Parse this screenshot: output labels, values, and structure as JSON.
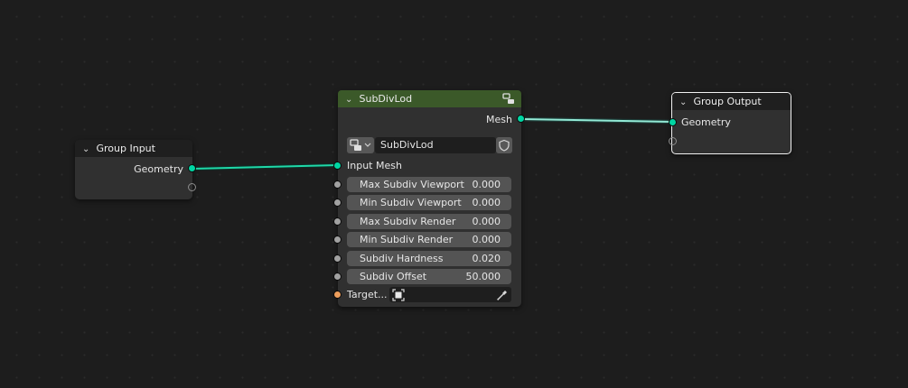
{
  "colors": {
    "geometry_socket": "#00d6a3",
    "float_socket": "#a1a1a1",
    "object_socket": "#ed9e5c",
    "group_header": "#3b5929",
    "input_output_header": "#1f1f1f",
    "link": "#66e0c0"
  },
  "group_input": {
    "title": "Group Input",
    "outputs": [
      {
        "label": "Geometry",
        "type": "geometry"
      }
    ]
  },
  "subdiv_node": {
    "title": "SubDivLod",
    "header_icon": "node-tree-icon",
    "output_label": "Mesh",
    "datablock": {
      "icon": "node-tree-icon",
      "name": "SubDivLod",
      "fake_user_icon": "shield-icon"
    },
    "input_mesh_label": "Input Mesh",
    "fields": [
      {
        "name": "Max Subdiv Viewport",
        "value": "0.000"
      },
      {
        "name": "Min Subdiv Viewport",
        "value": "0.000"
      },
      {
        "name": "Max Subdiv Render",
        "value": "0.000"
      },
      {
        "name": "Min Subdiv Render",
        "value": "0.000"
      },
      {
        "name": "Subdiv Hardness",
        "value": "0.020"
      },
      {
        "name": "Subdiv Offset",
        "value": "50.000"
      }
    ],
    "target": {
      "label": "Target...",
      "icon": "object-icon",
      "picker_icon": "eyedropper-icon"
    }
  },
  "group_output": {
    "title": "Group Output",
    "inputs": [
      {
        "label": "Geometry",
        "type": "geometry"
      }
    ]
  }
}
